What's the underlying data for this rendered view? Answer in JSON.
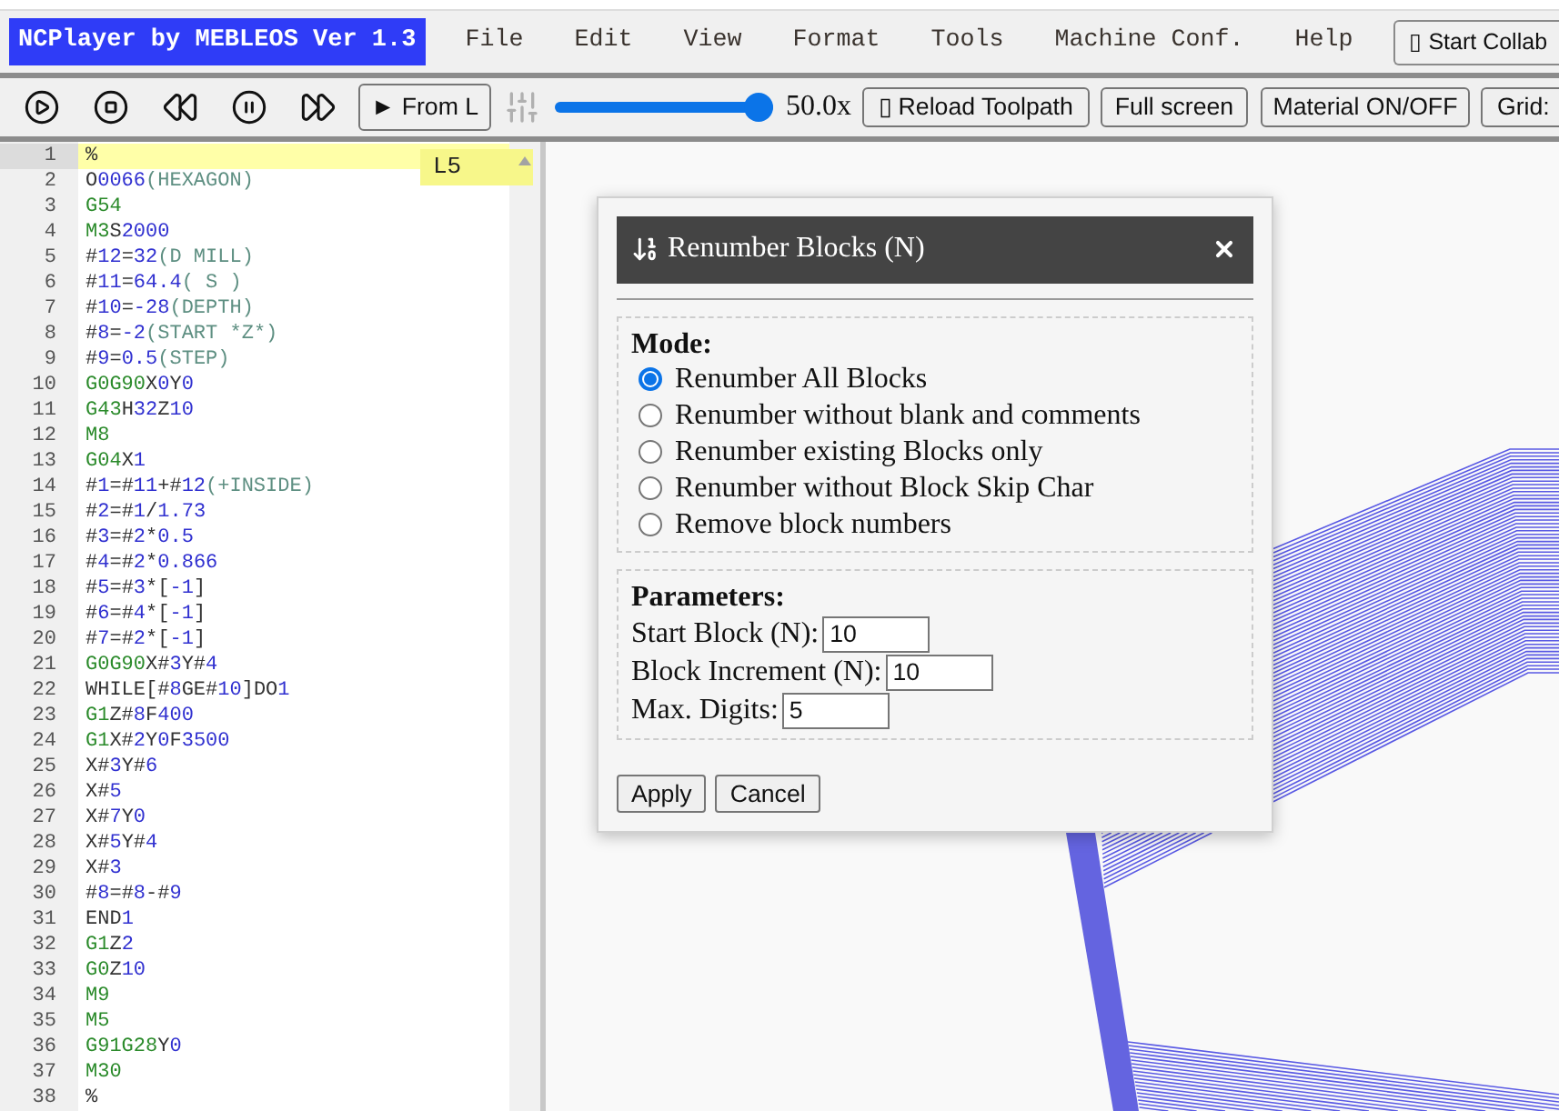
{
  "menubar": {
    "logo": "NCPlayer by MEBLEOS Ver 1.3",
    "menu_items": [
      "File",
      "Edit",
      "View",
      "Format",
      "Tools",
      "Machine Conf.",
      "Help"
    ],
    "collab_button": "▯ Start Collab"
  },
  "toolbar": {
    "from_line_button": "► From L",
    "speed_slider": {
      "level": 1,
      "reading": "50.0x"
    },
    "buttons": [
      "▯ Reload Toolpath",
      "Full screen",
      "Material ON/OFF",
      "Grid:"
    ]
  },
  "editor": {
    "line_tag": "L5",
    "lines": [
      {
        "number": "1",
        "active": true,
        "tokens": [
          {
            "kind": "plain",
            "text": "%"
          }
        ]
      },
      {
        "number": "2",
        "active": false,
        "tokens": [
          {
            "kind": "plain",
            "text": "O"
          },
          {
            "kind": "number",
            "text": "0066"
          },
          {
            "kind": "comment",
            "text": "(HEXAGON)"
          }
        ]
      },
      {
        "number": "3",
        "active": false,
        "tokens": [
          {
            "kind": "word",
            "text": "G54"
          }
        ]
      },
      {
        "number": "4",
        "active": false,
        "tokens": [
          {
            "kind": "word",
            "text": "M3"
          },
          {
            "kind": "plain",
            "text": "S"
          },
          {
            "kind": "number",
            "text": "2000"
          }
        ]
      },
      {
        "number": "5",
        "active": false,
        "tokens": [
          {
            "kind": "plain",
            "text": "#"
          },
          {
            "kind": "number",
            "text": "12"
          },
          {
            "kind": "plain",
            "text": "="
          },
          {
            "kind": "number",
            "text": "32"
          },
          {
            "kind": "comment",
            "text": "(D MILL)"
          }
        ]
      },
      {
        "number": "6",
        "active": false,
        "tokens": [
          {
            "kind": "plain",
            "text": "#"
          },
          {
            "kind": "number",
            "text": "11"
          },
          {
            "kind": "plain",
            "text": "="
          },
          {
            "kind": "number",
            "text": "64.4"
          },
          {
            "kind": "comment",
            "text": "( S )"
          }
        ]
      },
      {
        "number": "7",
        "active": false,
        "tokens": [
          {
            "kind": "plain",
            "text": "#"
          },
          {
            "kind": "number",
            "text": "10"
          },
          {
            "kind": "plain",
            "text": "="
          },
          {
            "kind": "number",
            "text": "-28"
          },
          {
            "kind": "comment",
            "text": "(DEPTH)"
          }
        ]
      },
      {
        "number": "8",
        "active": false,
        "tokens": [
          {
            "kind": "plain",
            "text": "#"
          },
          {
            "kind": "number",
            "text": "8"
          },
          {
            "kind": "plain",
            "text": "="
          },
          {
            "kind": "number",
            "text": "-2"
          },
          {
            "kind": "comment",
            "text": "(START *Z*)"
          }
        ]
      },
      {
        "number": "9",
        "active": false,
        "tokens": [
          {
            "kind": "plain",
            "text": "#"
          },
          {
            "kind": "number",
            "text": "9"
          },
          {
            "kind": "plain",
            "text": "="
          },
          {
            "kind": "number",
            "text": "0.5"
          },
          {
            "kind": "comment",
            "text": "(STEP)"
          }
        ]
      },
      {
        "number": "10",
        "active": false,
        "tokens": [
          {
            "kind": "word",
            "text": "G0G90"
          },
          {
            "kind": "plain",
            "text": "X"
          },
          {
            "kind": "number",
            "text": "0"
          },
          {
            "kind": "plain",
            "text": "Y"
          },
          {
            "kind": "number",
            "text": "0"
          }
        ]
      },
      {
        "number": "11",
        "active": false,
        "tokens": [
          {
            "kind": "word",
            "text": "G43"
          },
          {
            "kind": "plain",
            "text": "H"
          },
          {
            "kind": "number",
            "text": "32"
          },
          {
            "kind": "plain",
            "text": "Z"
          },
          {
            "kind": "number",
            "text": "10"
          }
        ]
      },
      {
        "number": "12",
        "active": false,
        "tokens": [
          {
            "kind": "word",
            "text": "M8"
          }
        ]
      },
      {
        "number": "13",
        "active": false,
        "tokens": [
          {
            "kind": "word",
            "text": "G04"
          },
          {
            "kind": "plain",
            "text": "X"
          },
          {
            "kind": "number",
            "text": "1"
          }
        ]
      },
      {
        "number": "14",
        "active": false,
        "tokens": [
          {
            "kind": "plain",
            "text": "#"
          },
          {
            "kind": "number",
            "text": "1"
          },
          {
            "kind": "plain",
            "text": "=#"
          },
          {
            "kind": "number",
            "text": "11"
          },
          {
            "kind": "plain",
            "text": "+#"
          },
          {
            "kind": "number",
            "text": "12"
          },
          {
            "kind": "comment",
            "text": "(+INSIDE)"
          }
        ]
      },
      {
        "number": "15",
        "active": false,
        "tokens": [
          {
            "kind": "plain",
            "text": "#"
          },
          {
            "kind": "number",
            "text": "2"
          },
          {
            "kind": "plain",
            "text": "=#"
          },
          {
            "kind": "number",
            "text": "1"
          },
          {
            "kind": "plain",
            "text": "/"
          },
          {
            "kind": "number",
            "text": "1.73"
          }
        ]
      },
      {
        "number": "16",
        "active": false,
        "tokens": [
          {
            "kind": "plain",
            "text": "#"
          },
          {
            "kind": "number",
            "text": "3"
          },
          {
            "kind": "plain",
            "text": "=#"
          },
          {
            "kind": "number",
            "text": "2"
          },
          {
            "kind": "plain",
            "text": "*"
          },
          {
            "kind": "number",
            "text": "0.5"
          }
        ]
      },
      {
        "number": "17",
        "active": false,
        "tokens": [
          {
            "kind": "plain",
            "text": "#"
          },
          {
            "kind": "number",
            "text": "4"
          },
          {
            "kind": "plain",
            "text": "=#"
          },
          {
            "kind": "number",
            "text": "2"
          },
          {
            "kind": "plain",
            "text": "*"
          },
          {
            "kind": "number",
            "text": "0.866"
          }
        ]
      },
      {
        "number": "18",
        "active": false,
        "tokens": [
          {
            "kind": "plain",
            "text": "#"
          },
          {
            "kind": "number",
            "text": "5"
          },
          {
            "kind": "plain",
            "text": "=#"
          },
          {
            "kind": "number",
            "text": "3"
          },
          {
            "kind": "plain",
            "text": "*["
          },
          {
            "kind": "number",
            "text": "-1"
          },
          {
            "kind": "plain",
            "text": "]"
          }
        ]
      },
      {
        "number": "19",
        "active": false,
        "tokens": [
          {
            "kind": "plain",
            "text": "#"
          },
          {
            "kind": "number",
            "text": "6"
          },
          {
            "kind": "plain",
            "text": "=#"
          },
          {
            "kind": "number",
            "text": "4"
          },
          {
            "kind": "plain",
            "text": "*["
          },
          {
            "kind": "number",
            "text": "-1"
          },
          {
            "kind": "plain",
            "text": "]"
          }
        ]
      },
      {
        "number": "20",
        "active": false,
        "tokens": [
          {
            "kind": "plain",
            "text": "#"
          },
          {
            "kind": "number",
            "text": "7"
          },
          {
            "kind": "plain",
            "text": "=#"
          },
          {
            "kind": "number",
            "text": "2"
          },
          {
            "kind": "plain",
            "text": "*["
          },
          {
            "kind": "number",
            "text": "-1"
          },
          {
            "kind": "plain",
            "text": "]"
          }
        ]
      },
      {
        "number": "21",
        "active": false,
        "tokens": [
          {
            "kind": "word",
            "text": "G0G90"
          },
          {
            "kind": "plain",
            "text": "X#"
          },
          {
            "kind": "number",
            "text": "3"
          },
          {
            "kind": "plain",
            "text": "Y#"
          },
          {
            "kind": "number",
            "text": "4"
          }
        ]
      },
      {
        "number": "22",
        "active": false,
        "tokens": [
          {
            "kind": "plain",
            "text": "WHILE[#"
          },
          {
            "kind": "number",
            "text": "8"
          },
          {
            "kind": "plain",
            "text": "GE#"
          },
          {
            "kind": "number",
            "text": "10"
          },
          {
            "kind": "plain",
            "text": "]DO"
          },
          {
            "kind": "number",
            "text": "1"
          }
        ]
      },
      {
        "number": "23",
        "active": false,
        "tokens": [
          {
            "kind": "word",
            "text": "G1"
          },
          {
            "kind": "plain",
            "text": "Z#"
          },
          {
            "kind": "number",
            "text": "8"
          },
          {
            "kind": "plain",
            "text": "F"
          },
          {
            "kind": "number",
            "text": "400"
          }
        ]
      },
      {
        "number": "24",
        "active": false,
        "tokens": [
          {
            "kind": "word",
            "text": "G1"
          },
          {
            "kind": "plain",
            "text": "X#"
          },
          {
            "kind": "number",
            "text": "2"
          },
          {
            "kind": "plain",
            "text": "Y"
          },
          {
            "kind": "number",
            "text": "0"
          },
          {
            "kind": "plain",
            "text": "F"
          },
          {
            "kind": "number",
            "text": "3500"
          }
        ]
      },
      {
        "number": "25",
        "active": false,
        "tokens": [
          {
            "kind": "plain",
            "text": "X#"
          },
          {
            "kind": "number",
            "text": "3"
          },
          {
            "kind": "plain",
            "text": "Y#"
          },
          {
            "kind": "number",
            "text": "6"
          }
        ]
      },
      {
        "number": "26",
        "active": false,
        "tokens": [
          {
            "kind": "plain",
            "text": "X#"
          },
          {
            "kind": "number",
            "text": "5"
          }
        ]
      },
      {
        "number": "27",
        "active": false,
        "tokens": [
          {
            "kind": "plain",
            "text": "X#"
          },
          {
            "kind": "number",
            "text": "7"
          },
          {
            "kind": "plain",
            "text": "Y"
          },
          {
            "kind": "number",
            "text": "0"
          }
        ]
      },
      {
        "number": "28",
        "active": false,
        "tokens": [
          {
            "kind": "plain",
            "text": "X#"
          },
          {
            "kind": "number",
            "text": "5"
          },
          {
            "kind": "plain",
            "text": "Y#"
          },
          {
            "kind": "number",
            "text": "4"
          }
        ]
      },
      {
        "number": "29",
        "active": false,
        "tokens": [
          {
            "kind": "plain",
            "text": "X#"
          },
          {
            "kind": "number",
            "text": "3"
          }
        ]
      },
      {
        "number": "30",
        "active": false,
        "tokens": [
          {
            "kind": "plain",
            "text": "#"
          },
          {
            "kind": "number",
            "text": "8"
          },
          {
            "kind": "plain",
            "text": "=#"
          },
          {
            "kind": "number",
            "text": "8"
          },
          {
            "kind": "plain",
            "text": "-#"
          },
          {
            "kind": "number",
            "text": "9"
          }
        ]
      },
      {
        "number": "31",
        "active": false,
        "tokens": [
          {
            "kind": "plain",
            "text": "END"
          },
          {
            "kind": "number",
            "text": "1"
          }
        ]
      },
      {
        "number": "32",
        "active": false,
        "tokens": [
          {
            "kind": "word",
            "text": "G1"
          },
          {
            "kind": "plain",
            "text": "Z"
          },
          {
            "kind": "number",
            "text": "2"
          }
        ]
      },
      {
        "number": "33",
        "active": false,
        "tokens": [
          {
            "kind": "word",
            "text": "G0"
          },
          {
            "kind": "plain",
            "text": "Z"
          },
          {
            "kind": "number",
            "text": "10"
          }
        ]
      },
      {
        "number": "34",
        "active": false,
        "tokens": [
          {
            "kind": "word",
            "text": "M9"
          }
        ]
      },
      {
        "number": "35",
        "active": false,
        "tokens": [
          {
            "kind": "word",
            "text": "M5"
          }
        ]
      },
      {
        "number": "36",
        "active": false,
        "tokens": [
          {
            "kind": "word",
            "text": "G91G28"
          },
          {
            "kind": "plain",
            "text": "Y"
          },
          {
            "kind": "number",
            "text": "0"
          }
        ]
      },
      {
        "number": "37",
        "active": false,
        "tokens": [
          {
            "kind": "word",
            "text": "M30"
          }
        ]
      },
      {
        "number": "38",
        "active": false,
        "tokens": [
          {
            "kind": "plain",
            "text": "%"
          }
        ]
      }
    ]
  },
  "dialog": {
    "title": "Renumber Blocks (N)",
    "mode": {
      "legend": "Mode:",
      "options": [
        {
          "label": "Renumber All Blocks",
          "selected": true
        },
        {
          "label": "Renumber without blank and comments",
          "selected": false
        },
        {
          "label": "Renumber existing Blocks only",
          "selected": false
        },
        {
          "label": "Renumber without Block Skip Char",
          "selected": false
        },
        {
          "label": "Remove block numbers",
          "selected": false
        }
      ]
    },
    "parameters": {
      "legend": "Parameters:",
      "fields": [
        {
          "label": "Start Block (N):",
          "value": "10"
        },
        {
          "label": "Block Increment (N):",
          "value": "10"
        },
        {
          "label": "Max. Digits:",
          "value": "5"
        }
      ]
    },
    "buttons": [
      "Apply",
      "Cancel"
    ]
  }
}
